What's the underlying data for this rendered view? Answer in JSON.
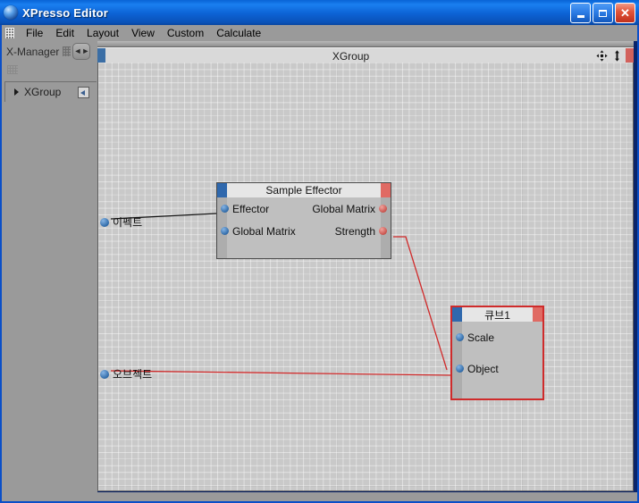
{
  "window": {
    "title": "XPresso Editor",
    "icon": "xpresso-sphere-icon",
    "buttons": {
      "minimize": "_",
      "maximize": "□",
      "close": "✕"
    }
  },
  "menubar": {
    "grip": "menu-grip-icon",
    "items": [
      "File",
      "Edit",
      "Layout",
      "View",
      "Custom",
      "Calculate"
    ]
  },
  "sidebar": {
    "title": "X-Manager",
    "grip_icon": "panel-grip-icon",
    "nav_button": "◄►",
    "tree": [
      {
        "label": "XGroup",
        "expander": "▶",
        "icon": "xgroup-node-icon"
      }
    ]
  },
  "canvas": {
    "title": "XGroup",
    "left_marker_color": "#3b6ea5",
    "right_marker_color": "#d2615c",
    "icons": [
      "move-icon",
      "up-down-arrow-icon"
    ],
    "free_ports": [
      {
        "name": "effect-port",
        "label": "이펙트"
      },
      {
        "name": "object-port",
        "label": "오브젝트"
      }
    ],
    "nodes": [
      {
        "id": "sample-effector",
        "title": "Sample Effector",
        "selected": false,
        "inputs": [
          "Effector",
          "Global Matrix"
        ],
        "outputs": [
          "Global Matrix",
          "Strength"
        ]
      },
      {
        "id": "cube1",
        "title": "큐브1",
        "selected": true,
        "inputs": [
          "Scale",
          "Object"
        ],
        "outputs": []
      }
    ],
    "wires": [
      {
        "name": "effect-to-effector",
        "color": "#111111"
      },
      {
        "name": "strength-to-scale",
        "color": "#d02a2a"
      },
      {
        "name": "object-to-object",
        "color": "#d02a2a"
      }
    ]
  },
  "colors": {
    "titlebar": "#1a7ff0",
    "panel": "#9a9a9a",
    "canvas": "#c9c9c9",
    "node_body": "#bfbfbf",
    "node_title": "#e6e6e6",
    "selection": "#cf2b2b",
    "input_port": "#2f6aa8",
    "output_port": "#c9524c"
  }
}
